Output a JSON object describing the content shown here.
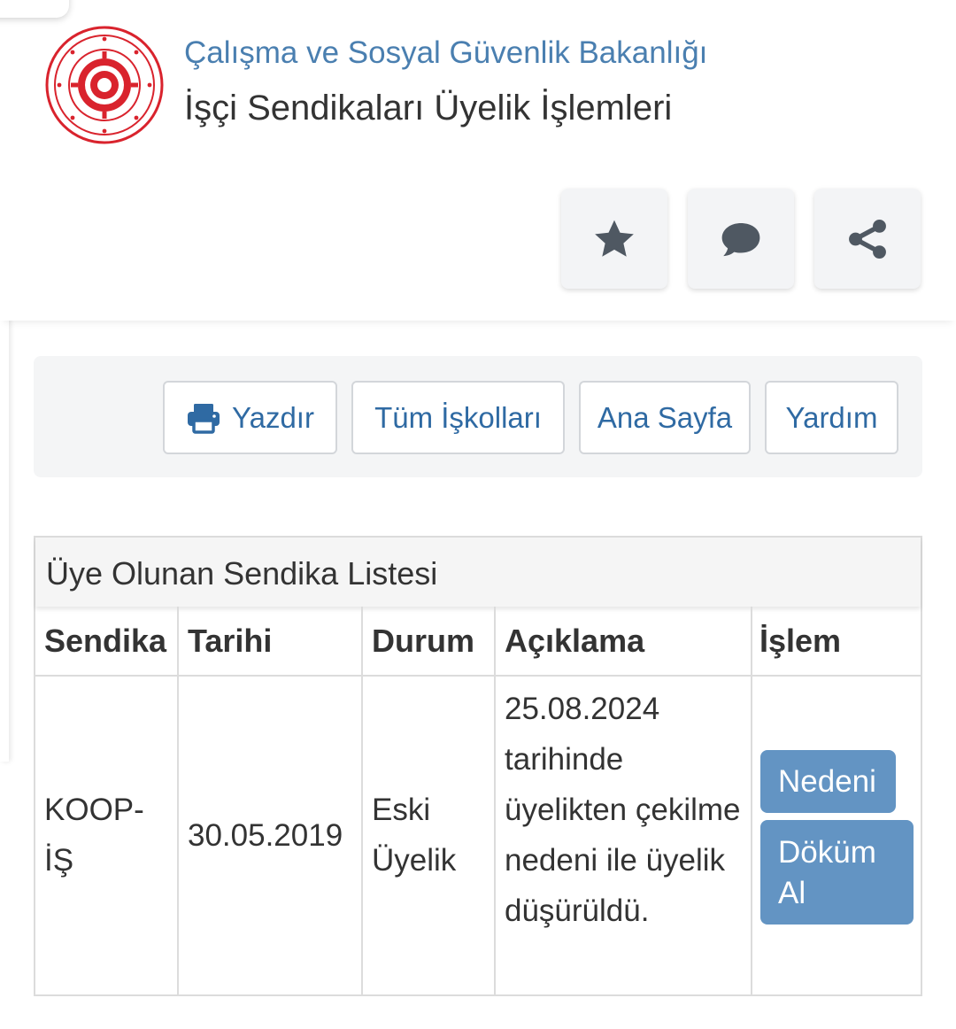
{
  "header": {
    "ministry": "Çalışma ve Sosyal Güvenlik Bakanlığı",
    "title": "İşçi Sendikaları Üyelik İşlemleri",
    "actions": [
      "star-icon",
      "comment-icon",
      "share-icon"
    ]
  },
  "toolbar": {
    "print": "Yazdır",
    "all_sectors": "Tüm İşkolları",
    "home": "Ana Sayfa",
    "help": "Yardım"
  },
  "panel": {
    "title": "Üye Olunan Sendika Listesi",
    "columns": [
      "Sendika",
      "Tarihi",
      "Durum",
      "Açıklama",
      "İşlem"
    ],
    "rows": [
      {
        "union": "KOOP-İŞ",
        "date": "30.05.2019",
        "status": "Eski Üyelik",
        "description": "25.08.2024 tarihinde üyelikten çekilme nedeni ile üyelik düşürüldü.",
        "actions": [
          "Nedeni",
          "Döküm Al"
        ]
      }
    ]
  },
  "colors": {
    "accent": "#4a7fb0",
    "button": "#6394c3",
    "seal": "#d9232d"
  }
}
